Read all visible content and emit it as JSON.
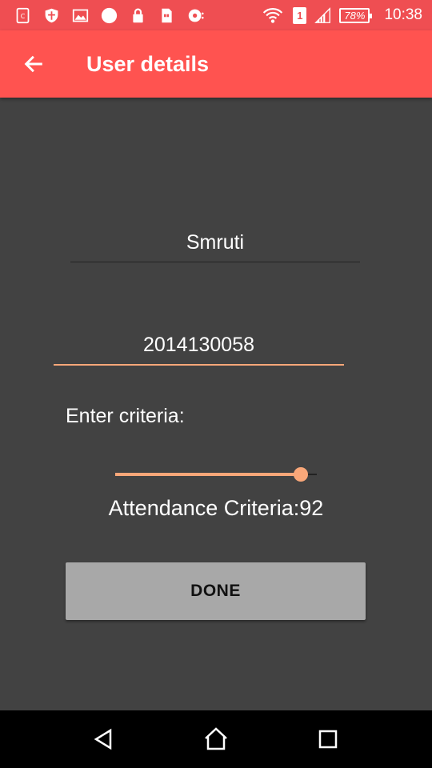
{
  "status_bar": {
    "icons": [
      "clipboard-icon",
      "shield-icon",
      "image-icon",
      "circle-icon",
      "lock-icon",
      "sim-card-icon",
      "camera-icon"
    ],
    "sim_slot": "1",
    "battery": "78%",
    "time": "10:38"
  },
  "app_bar": {
    "title": "User details",
    "back_icon": "arrow-left-icon",
    "color": "#ff5350"
  },
  "form": {
    "name_value": "Smruti",
    "id_value": "2014130058",
    "criteria_label": "Enter criteria:",
    "slider_value": 92,
    "slider_max": 100,
    "attendance_text": "Attendance Criteria:92",
    "done_label": "DONE"
  },
  "colors": {
    "accent": "#f9a779",
    "background": "#424242",
    "button": "#a8a8a8"
  },
  "nav_bar": {
    "buttons": [
      "back-triangle-icon",
      "home-icon",
      "recents-square-icon"
    ]
  }
}
